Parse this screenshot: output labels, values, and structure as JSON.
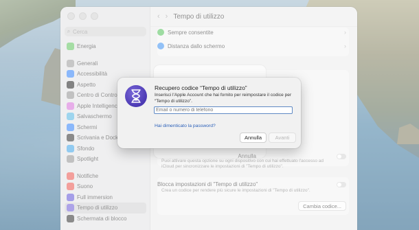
{
  "window": {
    "title": "Tempo di utilizzo"
  },
  "sidebar": {
    "search_placeholder": "Cerca",
    "items": [
      {
        "label": "Energia",
        "color": "#5bc25a"
      },
      {
        "label": "Generali",
        "color": "#9a9a9a"
      },
      {
        "label": "Accessibilità",
        "color": "#2d7ef7"
      },
      {
        "label": "Aspetto",
        "color": "#1c1c1c"
      },
      {
        "label": "Centro di Controllo",
        "color": "#8e8e8e"
      },
      {
        "label": "Apple Intelligence",
        "color": "#d36cd8"
      },
      {
        "label": "Salvaschermo",
        "color": "#4fb3e0"
      },
      {
        "label": "Schermi",
        "color": "#2d7ef7"
      },
      {
        "label": "Scrivania e Dock",
        "color": "#2a2a2a"
      },
      {
        "label": "Sfondo",
        "color": "#3aa1e6"
      },
      {
        "label": "Spotlight",
        "color": "#8e8e8e"
      },
      {
        "label": "Notifiche",
        "color": "#e9504a"
      },
      {
        "label": "Suono",
        "color": "#e9504a"
      },
      {
        "label": "Full immersion",
        "color": "#5b4fd6"
      },
      {
        "label": "Tempo di utilizzo",
        "color": "#6a58d6",
        "selected": true
      },
      {
        "label": "Schermata di blocco",
        "color": "#2a2a2a"
      }
    ]
  },
  "main": {
    "rows": {
      "always_allowed": "Sempre consentite",
      "screen_distance": "Distanza dallo schermo",
      "share_text": "Puoi attivare questa opzione su ogni dispositivo con cui hai effettuato l'accesso ad iCloud per sincronizzare le impostazioni di \"Tempo di utilizzo\".",
      "lock_title": "Blocca impostazioni di \"Tempo di utilizzo\"",
      "lock_desc": "Crea un codice per rendere più sicure le impostazioni di \"Tempo di utilizzo\".",
      "change_code": "Cambia codice..."
    },
    "behind_sheet_cancel": "Annulla"
  },
  "dialog": {
    "title": "Recupero codice “Tempo di utilizzo”",
    "message": "Inserisci l'Apple Account che hai fornito per reimpostare il codice per “Tempo di utilizzo”.",
    "input_placeholder": "Email o numero di telefono",
    "forgot_link": "Hai dimenticato la password?",
    "cancel": "Annulla",
    "next": "Avanti",
    "icon": "hourglass-icon",
    "icon_color": "#4b39b3"
  }
}
